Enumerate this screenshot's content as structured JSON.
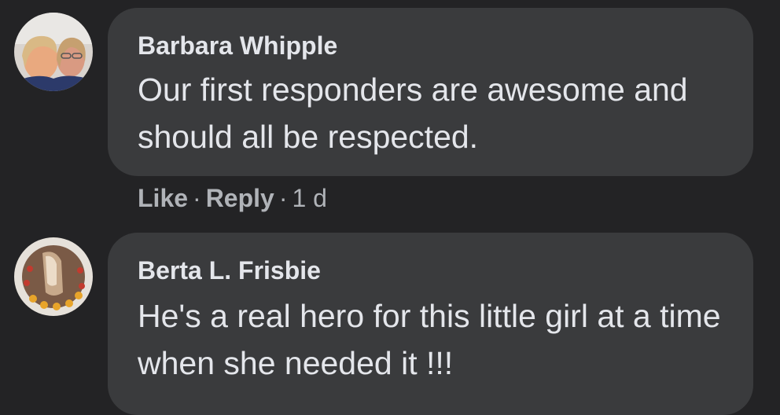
{
  "comments": [
    {
      "author": "Barbara Whipple",
      "text": "Our first responders are awesome and should all be respected.",
      "actions": {
        "like": "Like",
        "reply": "Reply",
        "separator": "·",
        "time": "1 d"
      }
    },
    {
      "author": "Berta L. Frisbie",
      "text": "He's a real hero for this little girl at a time when she needed it !!!"
    }
  ],
  "colors": {
    "background": "#232325",
    "bubble": "#3a3b3d",
    "text": "#e4e6eb",
    "secondary": "#b0b3b8"
  }
}
